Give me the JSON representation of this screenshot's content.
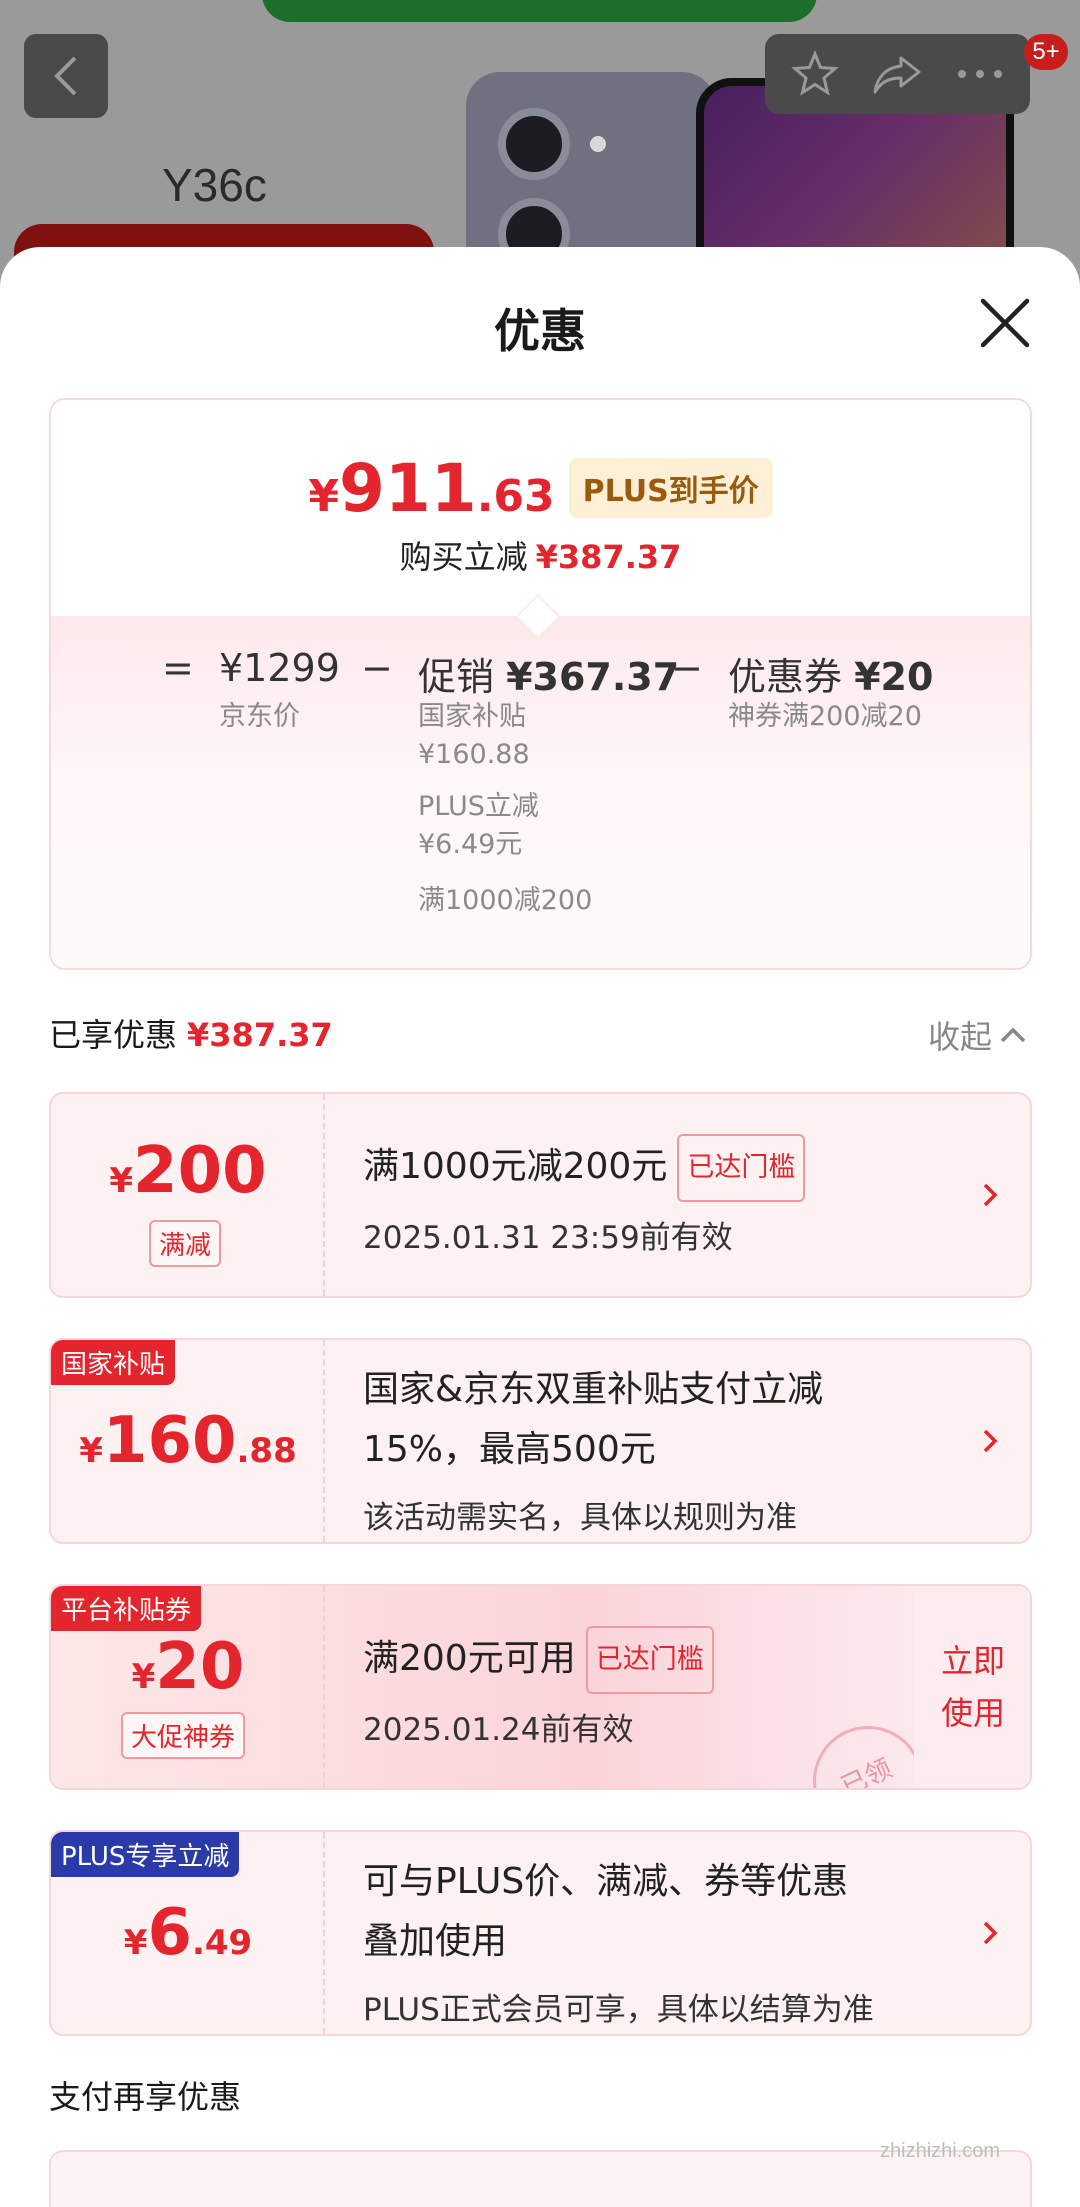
{
  "backdrop": {
    "model_name": "Y36c",
    "badge_count": "5+"
  },
  "sheet": {
    "title": "优惠"
  },
  "summary": {
    "price_yen": "¥",
    "price_int": "911",
    "price_dec": ".63",
    "plus_tag": "PLUS到手价",
    "save_label": "购买立减",
    "save_amount": "¥387.37",
    "eq": "=",
    "minus": "−",
    "jd_price": "¥1299",
    "jd_price_label": "京东价",
    "promo_label": "促销",
    "promo_amount": "¥367.37",
    "promo_items": [
      "国家补贴",
      "¥160.88",
      "PLUS立减",
      "¥6.49元",
      "满1000减200"
    ],
    "coupon_label": "优惠券",
    "coupon_amount": "¥20",
    "coupon_desc": "神券满200减20"
  },
  "enjoyed": {
    "label": "已享优惠",
    "amount": "¥387.37",
    "collapse": "收起"
  },
  "coupons": [
    {
      "yen": "¥",
      "int": "200",
      "dec": "",
      "type": "满减",
      "title": "满1000元减200元",
      "tag": "已达门槛",
      "sub": "2025.01.31 23:59前有效"
    },
    {
      "corner": "国家补贴",
      "yen": "¥",
      "int": "160",
      "dec": ".88",
      "title_line1": "国家&京东双重补贴支付立减",
      "title_line2": "15%，最高500元",
      "sub": "该活动需实名，具体以规则为准"
    },
    {
      "corner": "平台补贴券",
      "yen": "¥",
      "int": "20",
      "dec": "",
      "type": "大促神券",
      "title": "满200元可用",
      "tag": "已达门槛",
      "sub": "2025.01.24前有效",
      "action_line1": "立即",
      "action_line2": "使用",
      "stamp": "已领"
    },
    {
      "corner": "PLUS专享立减",
      "yen": "¥",
      "int": "6",
      "dec": ".49",
      "title_line1": "可与PLUS价、满减、券等优惠",
      "title_line2": "叠加使用",
      "sub": "PLUS正式会员可享，具体以结算为准"
    }
  ],
  "pay": {
    "label": "支付再享优惠"
  },
  "watermark": "zhizhizhi.com",
  "colors": {
    "accent": "#e4252d",
    "plus_tag_bg": "#fdf0d6",
    "plus_blue": "#2a3aa8"
  }
}
